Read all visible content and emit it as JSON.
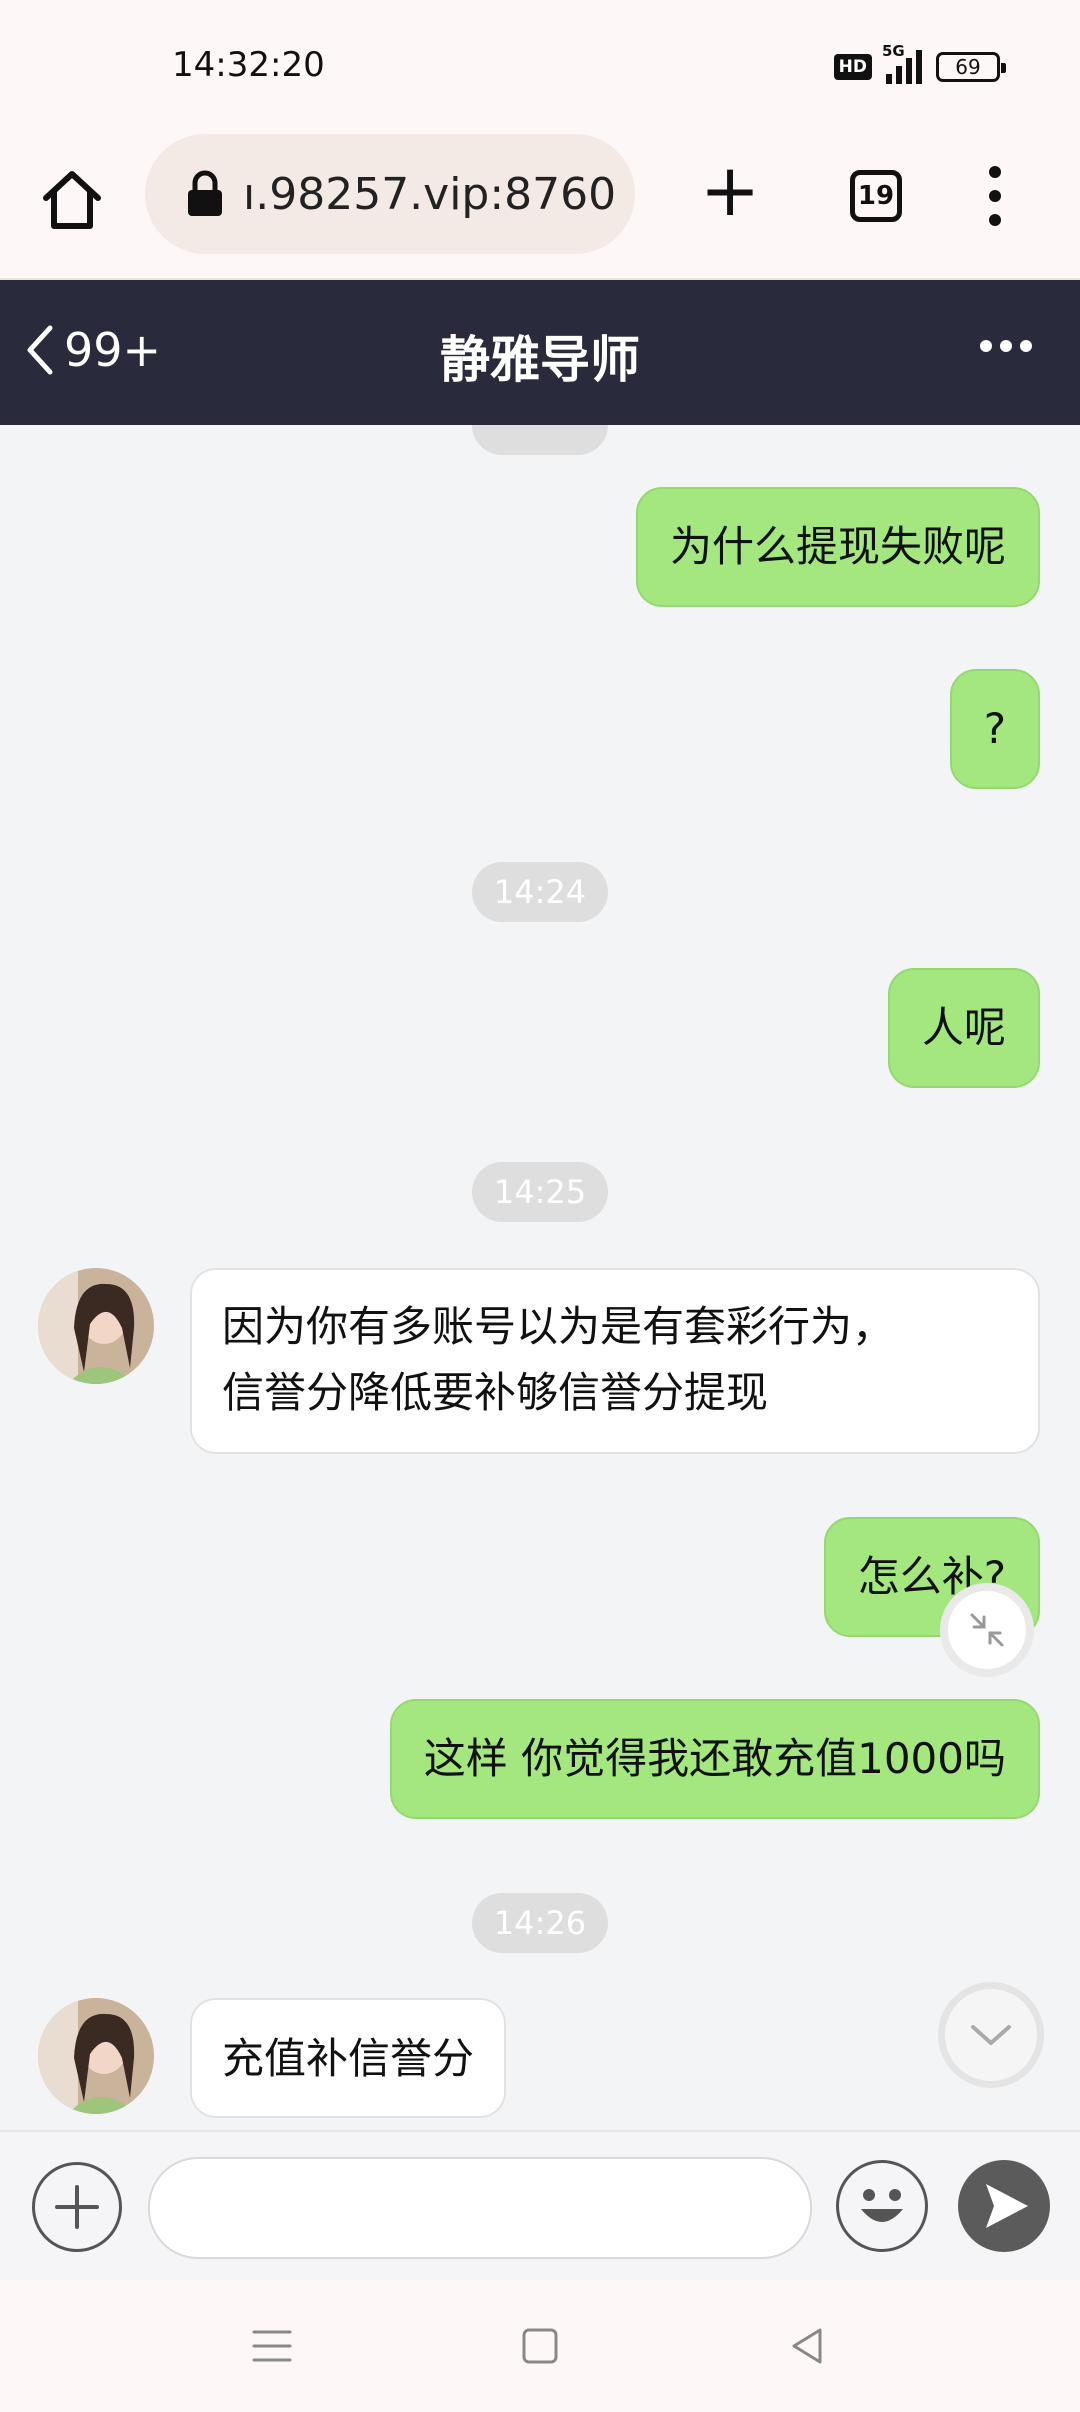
{
  "status_bar": {
    "time": "14:32:20",
    "hd_label": "HD",
    "network_label": "5G",
    "battery_level": "69"
  },
  "browser": {
    "url": "ı.98257.vip:8760",
    "tab_count": "19"
  },
  "chat_header": {
    "back_count": "99+",
    "title": "静雅导师"
  },
  "messages": [
    {
      "sender": "me",
      "text": "为什么提现失败呢"
    },
    {
      "sender": "me",
      "text": "?"
    },
    {
      "type": "time",
      "text": "14:24"
    },
    {
      "sender": "me",
      "text": "人呢"
    },
    {
      "type": "time",
      "text": "14:25"
    },
    {
      "sender": "them",
      "line1": "因为你有多账号以为是有套彩行为，",
      "line2": "信誉分降低要补够信誉分提现"
    },
    {
      "sender": "me",
      "text": "怎么补?"
    },
    {
      "sender": "me",
      "text": "这样 你觉得我还敢充值1000吗"
    },
    {
      "type": "time",
      "text": "14:26"
    },
    {
      "sender": "them",
      "text": "充值补信誉分"
    }
  ],
  "colors": {
    "header_bg": "#292b3d",
    "my_bubble": "#a3e77e",
    "their_bubble": "#ffffff",
    "chat_bg": "#f3f4f6"
  }
}
